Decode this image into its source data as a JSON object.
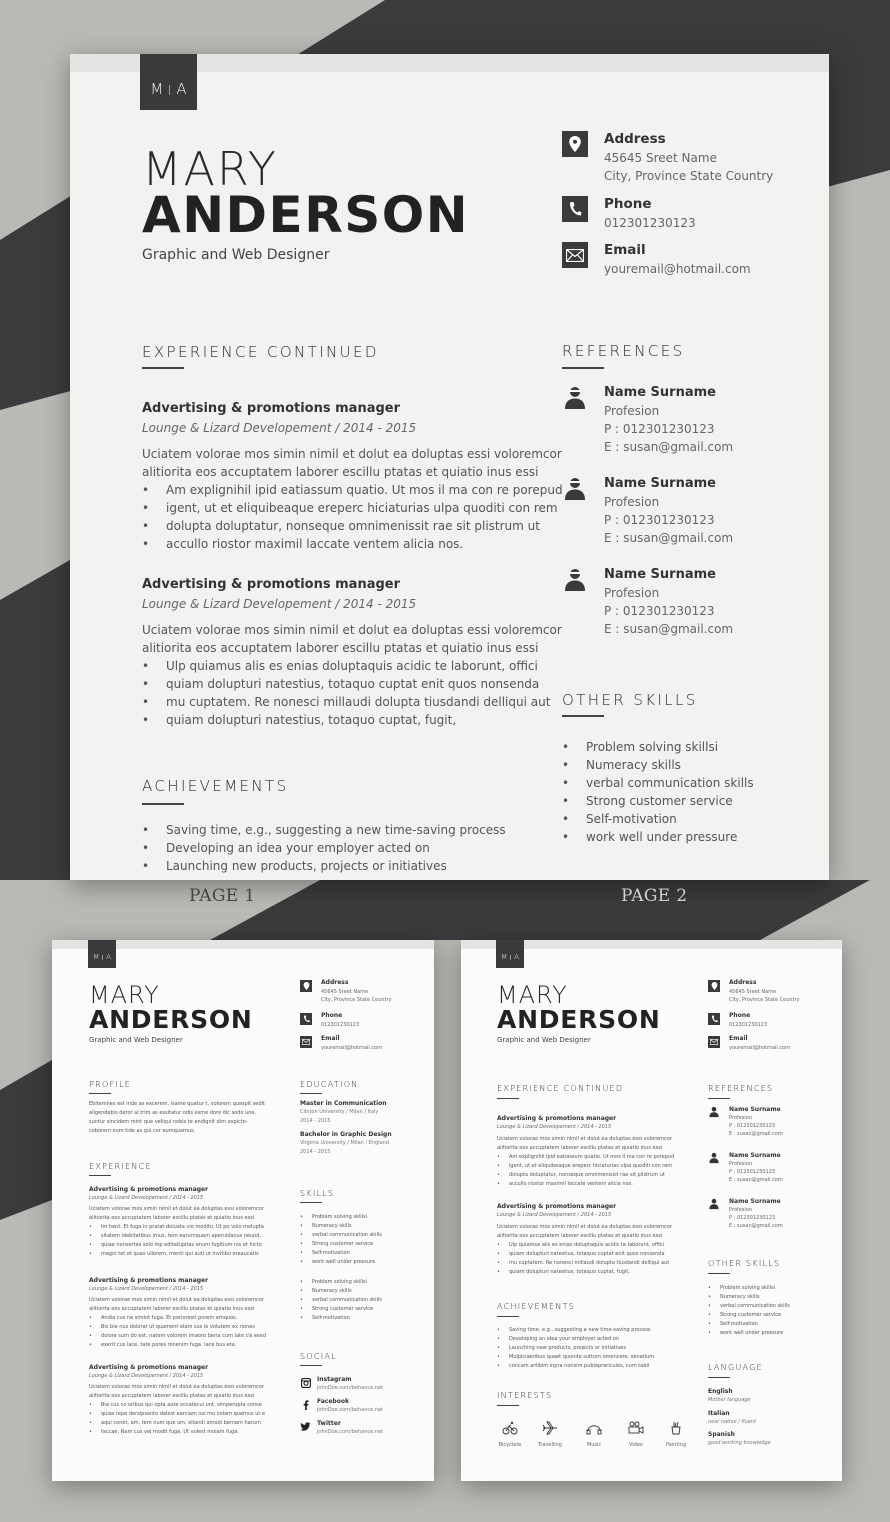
{
  "colors": {
    "background_light": "#b9bab6",
    "background_dark": "#3b3b3d",
    "paper": "#f2f2f1",
    "accent_dark": "#3a3a3c",
    "text_primary": "#333333",
    "text_secondary": "#666666"
  },
  "labels": {
    "page1": "PAGE 1",
    "page2": "PAGE 2"
  },
  "resume": {
    "monogram_left": "M",
    "monogram_right": "A",
    "first_name": "MARY",
    "last_name": "ANDERSON",
    "job_title": "Graphic and Web Designer",
    "contact": {
      "address_label": "Address",
      "address_line1": "45645 Sreet Name",
      "address_line2": "City, Province State Country",
      "phone_label": "Phone",
      "phone_value": "012301230123",
      "email_label": "Email",
      "email_value": "youremail@hotmail.com"
    }
  },
  "page2": {
    "experience_title": "EXPERIENCE CONTINUED",
    "jobs": [
      {
        "title": "Advertising & promotions manager",
        "subtitle": "Lounge & Lizard Developement / 2014 - 2015",
        "intro1": "Uciatem volorae mos simin nimil et dolut ea doluptas essi voloremcor",
        "intro2": "alitiorita eos accuptatem laborer escillu ptatas et quiatio inus essi",
        "bullets": [
          "Am explignihil ipid eatiassum quatio. Ut mos il ma con re porepud",
          "igent, ut et eliquibeaque ereperc hiciaturias ulpa quoditi con rem",
          "dolupta doluptatur, nonseque omnimenissit rae sit plistrum ut",
          "accullo riostor maximil laccate ventem alicia nos."
        ]
      },
      {
        "title": "Advertising & promotions manager",
        "subtitle": "Lounge & Lizard Developement / 2014 - 2015",
        "intro1": "Uciatem volorae mos simin nimil et dolut ea doluptas essi voloremcor",
        "intro2": "alitiorita eos accuptatem laborer escillu ptatas et quiatio inus essi",
        "bullets": [
          "Ulp quiamus alis es enias doluptaquis acidic te laborunt, offici",
          "quiam dolupturi natestius, totaquo cuptat enit quos nonsenda",
          "mu cuptatem. Re nonesci millaudi dolupta tiusdandi delliqui aut",
          "quiam dolupturi natestius, totaquo cuptat, fugit,"
        ]
      }
    ],
    "achievements_title": "ACHIEVEMENTS",
    "achievements": [
      "Saving time, e.g., suggesting a new time-saving process",
      "Developing an idea your employer acted on",
      "Launching new products, projects or initiatives",
      "Mulpiciaeribus quaet quunde suttum omencere, senatium",
      "concam artibim inpra nonsim publepraricules, cum tabil"
    ],
    "references_title": "REFERENCES",
    "references": [
      {
        "name": "Name Surname",
        "profession": "Profesion",
        "phone": "P : 012301230123",
        "email": "E : susan@gmail.com"
      },
      {
        "name": "Name Surname",
        "profession": "Profesion",
        "phone": "P : 012301230123",
        "email": "E : susan@gmail.com"
      },
      {
        "name": "Name Surname",
        "profession": "Profesion",
        "phone": "P : 012301230123",
        "email": "E : susan@gmail.com"
      }
    ],
    "other_skills_title": "OTHER SKILLS",
    "other_skills": [
      "Problem solving skillsi",
      "Numeracy skills",
      "verbal communication skills",
      "Strong customer service",
      "Self-motivation",
      "work well under pressure"
    ],
    "interests_title": "INTERESTS",
    "interests": [
      {
        "label": "Bicyclete",
        "icon": "bicycle-icon"
      },
      {
        "label": "Travelling",
        "icon": "airplane-icon"
      },
      {
        "label": "Music",
        "icon": "headphones-icon"
      },
      {
        "label": "Video",
        "icon": "video-camera-icon"
      },
      {
        "label": "Painting",
        "icon": "paint-icon"
      }
    ],
    "language_title": "LANGUAGE",
    "languages": [
      {
        "name": "English",
        "level": "Mother language"
      },
      {
        "name": "Italian",
        "level": "near native / fluent"
      },
      {
        "name": "Spanish",
        "level": "good working knowledge"
      }
    ]
  },
  "page1": {
    "profile_title": "PROFILE",
    "profile_lines": [
      "Ebitemnes est inde as excerem, isame quatur t, volorem quaspit sedit",
      "aligendebis deror al trim as essitatur odis esme dore dic sodo une,",
      "suntur sincidem mint que veliqui nobis te endignit dim expicto-",
      "coborem eum tide as qui cor eumquamus."
    ],
    "experience_title": "EXPERIENCE",
    "jobs": [
      {
        "title": "Advertising & promotions manager",
        "subtitle": "Lounge & Lizard Developement / 2014 - 2015",
        "intro1": "Uciatem volorae mos simin nimil et dolut ea doluptas essi voloremcor",
        "intro2": "alitiorita eos accuptatem laborer escillu ptatas et quiatio inus essi",
        "bullets": [
          "Im hent. Et fuga in pratat doluata vio modito. Ut po volo molupta",
          "sitatem idebitatibus imus, tem earumquam aperuidacus neund,",
          "quiae nonsertas solo mp editatupitas enum fugitium nis et hicto",
          "magni tet et quas ullorem, menti qui auti ut invitibo ereaucatis"
        ]
      },
      {
        "title": "Advertising & promotions manager",
        "subtitle": "Lounge & Lizard Developement / 2014 - 2015",
        "intro1": "Uciatem volorae mos simin nimil et dolut ea doluptas essi voloremcor",
        "intro2": "alitiorita eos accuptatem laborer escillu ptatas et quiatio inus essi",
        "bullets": [
          "Andia cus ne simint fuga. Et porioresit porem amquos.",
          "Bis bie nus dolorat ut quament elam sus le volutem ex riones",
          "dolore sum do est, natem volorem imaoro beria cum late cis esed",
          "exerit cus lace, tate pores ronenim fuga. Iace bus eta."
        ]
      },
      {
        "title": "Advertising & promotions manager",
        "subtitle": "Lounge & Lizard Developement / 2014 - 2015",
        "intro1": "Uciatem volorae mos simin nimil et dolut ea doluptas essi voloremcor",
        "intro2": "alitiorita eos accuptatem laborer escillu ptatas et quiatio inus essi",
        "bullets": [
          "Bia cus co oribus qui opta aute occatecui unt, simperupta conse",
          "quias repe dersipsanto delest earciam ius mo volam quamus ut e",
          "aqui conet, am, tem num que um, ellandi amodi bernam harum",
          "faccae. Nam cus vel modit fuga. Ut volest molam fuga."
        ]
      }
    ],
    "education_title": "EDUCATION",
    "education": [
      {
        "degree": "Master in Communication",
        "school": "Clinton University / Milan / Italy",
        "years": "2014 - 2015"
      },
      {
        "degree": "Bachelor in Graphic Design",
        "school": "Virginia University / Milan / England",
        "years": "2014 - 2015"
      }
    ],
    "skills_title": "SKILLS",
    "skills_a": [
      "Problem solving skillsi",
      "Numeracy skills",
      "verbal communication skills",
      "Strong customer service",
      "Self-motivation",
      "work well under pressure"
    ],
    "skills_b": [
      "Problem solving skillsi",
      "Numeracy skills",
      "verbal communication skills",
      "Strong customer service",
      "Self-motivation"
    ],
    "social_title": "SOCIAL",
    "social": [
      {
        "label": "Instagram",
        "handle": "johnDoe.com/behance.net",
        "icon": "instagram-icon"
      },
      {
        "label": "Facebook",
        "handle": "johnDoe.com/behance.net",
        "icon": "facebook-icon"
      },
      {
        "label": "Twitter",
        "handle": "johnDoe.com/behance.net",
        "icon": "twitter-icon"
      }
    ]
  }
}
